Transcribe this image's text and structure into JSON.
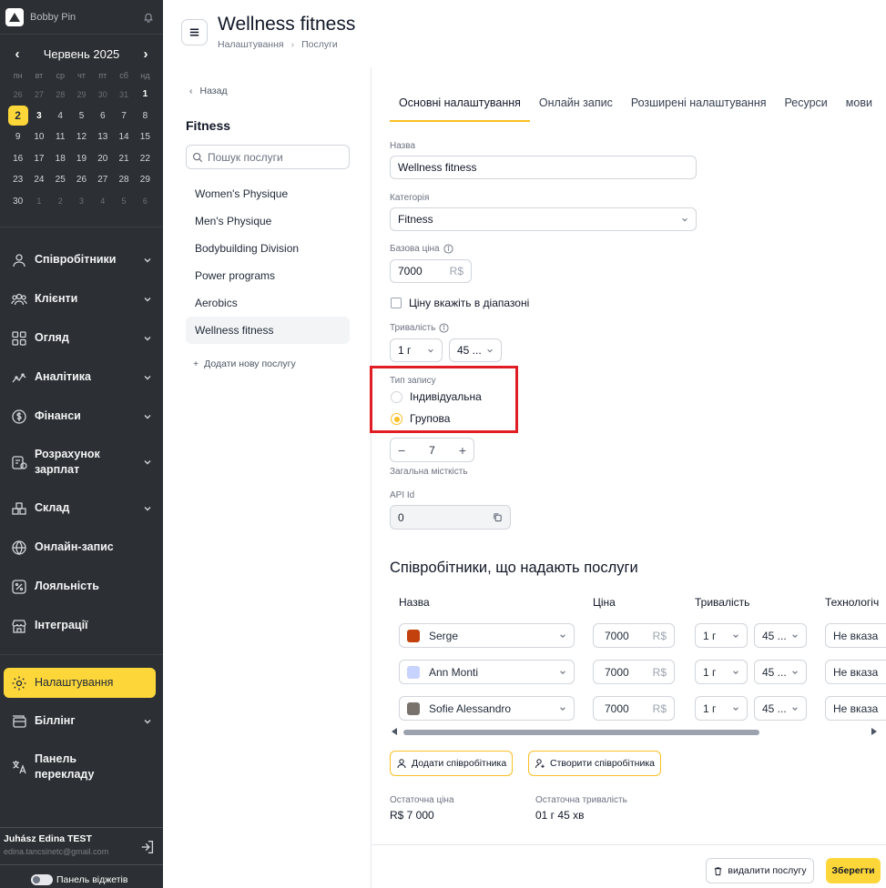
{
  "sidebar": {
    "company": "Bobby Pin",
    "calendar": {
      "month": "Червень 2025",
      "weekdays": [
        "пн",
        "вт",
        "ср",
        "чт",
        "пт",
        "сб",
        "нд"
      ],
      "days": [
        {
          "d": "26",
          "m": true
        },
        {
          "d": "27",
          "m": true
        },
        {
          "d": "28",
          "m": true
        },
        {
          "d": "29",
          "m": true
        },
        {
          "d": "30",
          "m": true
        },
        {
          "d": "31",
          "m": true
        },
        {
          "d": "1",
          "s": true
        },
        {
          "d": "2",
          "t": true
        },
        {
          "d": "3",
          "s": true
        },
        {
          "d": "4"
        },
        {
          "d": "5"
        },
        {
          "d": "6"
        },
        {
          "d": "7"
        },
        {
          "d": "8"
        },
        {
          "d": "9"
        },
        {
          "d": "10"
        },
        {
          "d": "11"
        },
        {
          "d": "12"
        },
        {
          "d": "13"
        },
        {
          "d": "14"
        },
        {
          "d": "15"
        },
        {
          "d": "16"
        },
        {
          "d": "17"
        },
        {
          "d": "18"
        },
        {
          "d": "19"
        },
        {
          "d": "20"
        },
        {
          "d": "21"
        },
        {
          "d": "22"
        },
        {
          "d": "23"
        },
        {
          "d": "24"
        },
        {
          "d": "25"
        },
        {
          "d": "26"
        },
        {
          "d": "27"
        },
        {
          "d": "28"
        },
        {
          "d": "29"
        },
        {
          "d": "30"
        },
        {
          "d": "1",
          "m": true
        },
        {
          "d": "2",
          "m": true
        },
        {
          "d": "3",
          "m": true
        },
        {
          "d": "4",
          "m": true
        },
        {
          "d": "5",
          "m": true
        },
        {
          "d": "6",
          "m": true
        }
      ]
    },
    "nav": [
      {
        "label": "Співробітники",
        "icon": "user-icon"
      },
      {
        "label": "Клієнти",
        "icon": "users-icon"
      },
      {
        "label": "Огляд",
        "icon": "grid-icon"
      },
      {
        "label": "Аналітика",
        "icon": "chart-icon"
      },
      {
        "label": "Фінанси",
        "icon": "dollar-icon"
      },
      {
        "label": "Розрахунок зарплат",
        "icon": "payroll-icon"
      },
      {
        "label": "Склад",
        "icon": "boxes-icon"
      },
      {
        "label": "Онлайн-запис",
        "icon": "globe-icon"
      },
      {
        "label": "Лояльність",
        "icon": "percent-icon"
      },
      {
        "label": "Інтеграції",
        "icon": "store-icon"
      }
    ],
    "settings_label": "Налаштування",
    "billing_label": "Біллінг",
    "translation_label": "Панель перекладу",
    "user_name": "Juhász Edina TEST",
    "user_email": "edina.tancsinetc@gmail.com",
    "widgets_label": "Панель віджетів"
  },
  "header": {
    "title": "Wellness fitness",
    "breadcrumb": [
      "Налаштування",
      "Послуги"
    ]
  },
  "services": {
    "back_label": "Назад",
    "category": "Fitness",
    "search_placeholder": "Пошук послуги",
    "items": [
      "Women's Physique",
      "Men's Physique",
      "Bodybuilding Division",
      "Power programs",
      "Aerobics",
      "Wellness fitness"
    ],
    "add_label": "Додати нову послугу"
  },
  "tabs": [
    "Основні налаштування",
    "Онлайн запис",
    "Розширені налаштування",
    "Ресурси",
    "мови"
  ],
  "form": {
    "name_label": "Назва",
    "name_value": "Wellness fitness",
    "category_label": "Категорія",
    "category_value": "Fitness",
    "price_label": "Базова ціна",
    "price_value": "7000",
    "currency": "R$",
    "range_label": "Ціну вкажіть в діапазоні",
    "duration_label": "Тривалість",
    "duration_hours": "1 г",
    "duration_minutes": "45 ...",
    "booking_type_label": "Тип запису",
    "booking_individual": "Індивідуальна",
    "booking_group": "Групова",
    "capacity_value": "7",
    "capacity_label": "Загальна місткість",
    "api_label": "API Id",
    "api_value": "0"
  },
  "employees": {
    "title": "Співробітники, що надають послуги",
    "columns": [
      "Назва",
      "Ціна",
      "Тривалість",
      "Технологіч"
    ],
    "rows": [
      {
        "name": "Serge",
        "price": "7000",
        "hours": "1 г",
        "minutes": "45 ...",
        "tech": "Не вказа"
      },
      {
        "name": "Ann Monti",
        "price": "7000",
        "hours": "1 г",
        "minutes": "45 ...",
        "tech": "Не вказа"
      },
      {
        "name": "Sofie Alessandro",
        "price": "7000",
        "hours": "1 г",
        "minutes": "45 ...",
        "tech": "Не вказа"
      }
    ],
    "add_label": "Додати співробітника",
    "create_label": "Створити співробітника"
  },
  "summary": {
    "price_label": "Остаточна ціна",
    "price_value": "R$ 7 000",
    "duration_label": "Остаточна тривалість",
    "duration_value": "01 г 45 хв"
  },
  "footer": {
    "delete_label": "видалити послугу",
    "save_label": "Зберегти"
  },
  "colors": {
    "accent": "#fdd73a",
    "sidebar_bg": "#2c2f33",
    "highlight_box": "#e11d24"
  }
}
